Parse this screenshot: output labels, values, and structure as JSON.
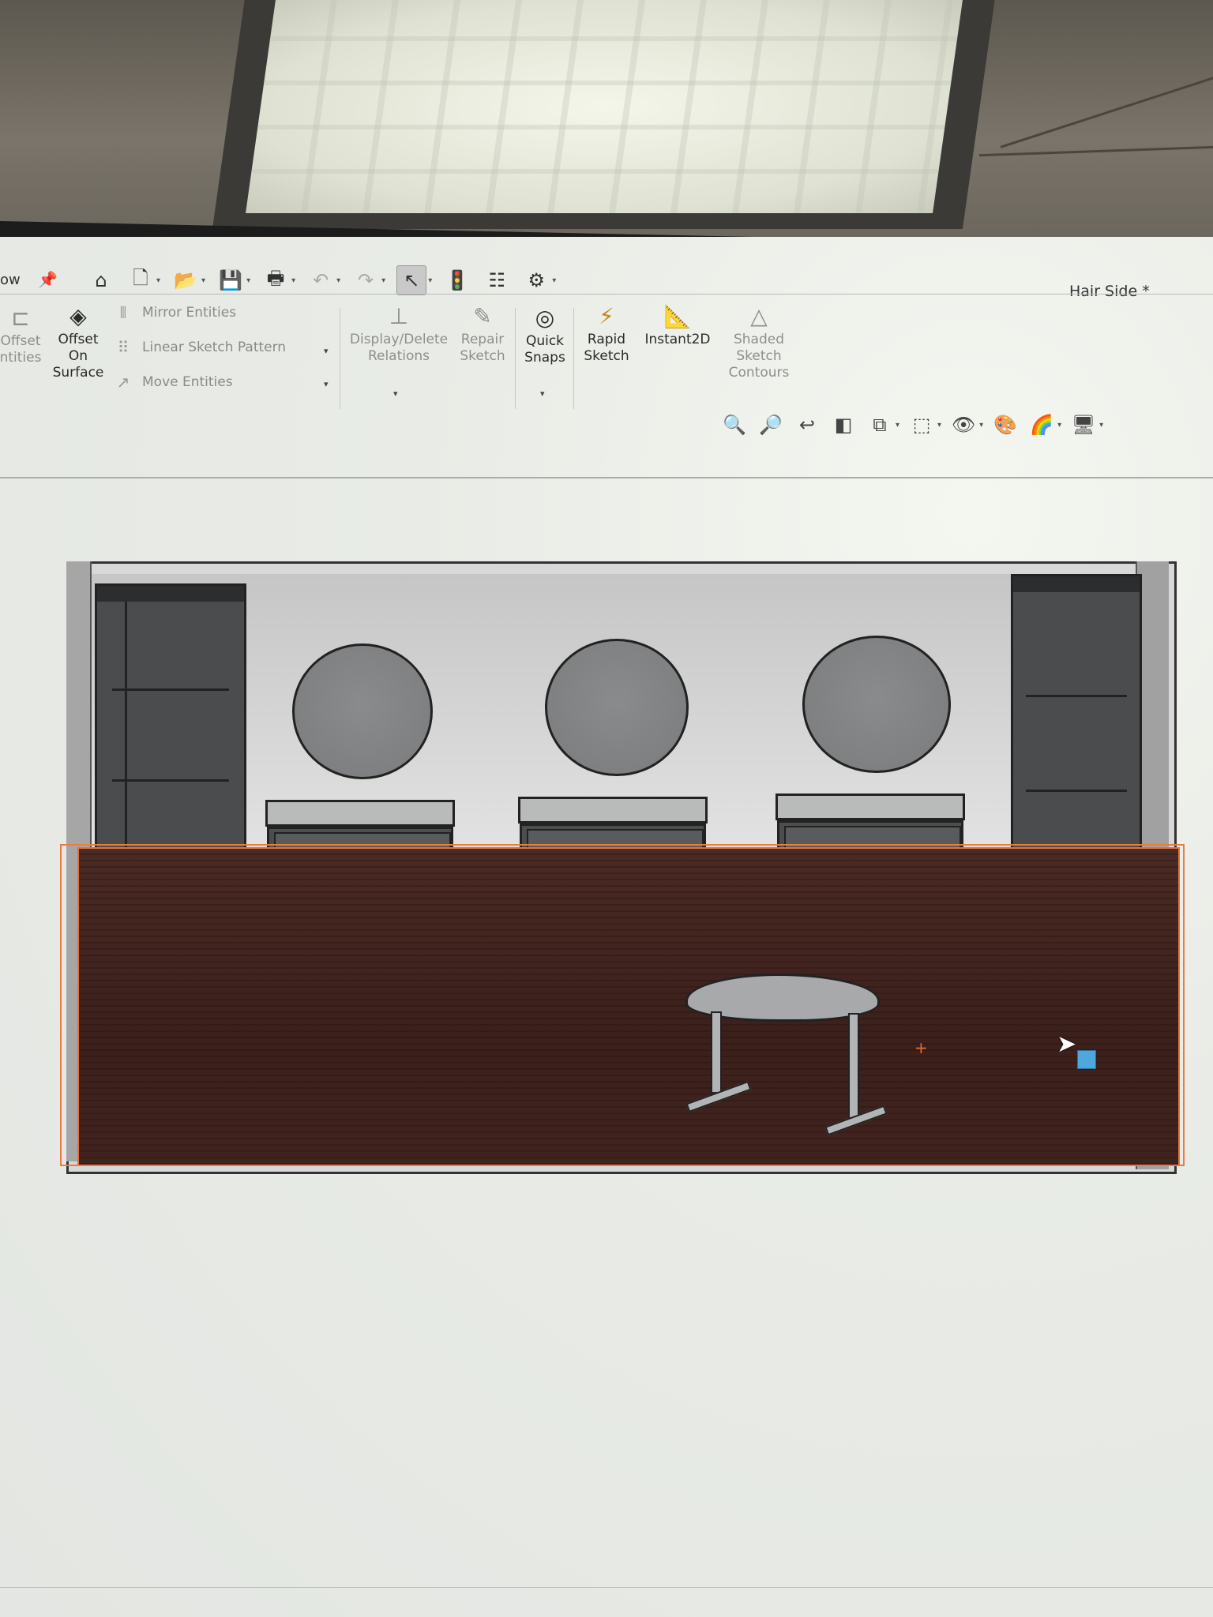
{
  "window": {
    "document_title": "Hair Side *"
  },
  "quick_access": {
    "partial_left_label": "ow",
    "icons": [
      "pin-icon",
      "home-icon",
      "new-document-icon",
      "open-icon",
      "save-icon",
      "print-icon",
      "undo-icon",
      "redo-icon",
      "select-icon",
      "rebuild-icon",
      "file-properties-icon",
      "options-icon"
    ]
  },
  "ribbon": {
    "offset_entities_partial": [
      "Offset",
      "ntities"
    ],
    "offset_on_surface": [
      "Offset",
      "On",
      "Surface"
    ],
    "mirror_entities": "Mirror Entities",
    "linear_sketch_pattern": "Linear Sketch Pattern",
    "move_entities": "Move Entities",
    "display_delete_relations": [
      "Display/Delete",
      "Relations"
    ],
    "repair_sketch": [
      "Repair",
      "Sketch"
    ],
    "quick_snaps": [
      "Quick",
      "Snaps"
    ],
    "rapid_sketch": [
      "Rapid",
      "Sketch"
    ],
    "instant2d": "Instant2D",
    "shaded_sketch_contours": [
      "Shaded",
      "Sketch",
      "Contours"
    ]
  },
  "view_toolbar": {
    "icons": [
      "zoom-to-fit-icon",
      "zoom-to-area-icon",
      "previous-view-icon",
      "section-view-icon",
      "view-orientation-icon",
      "display-style-icon",
      "hide-show-items-icon",
      "edit-appearance-icon",
      "apply-scene-icon",
      "view-settings-icon"
    ]
  },
  "colors": {
    "floor": "#3b201c",
    "selection_outline": "#ee7a3d",
    "wall": "#d7d8d7"
  }
}
